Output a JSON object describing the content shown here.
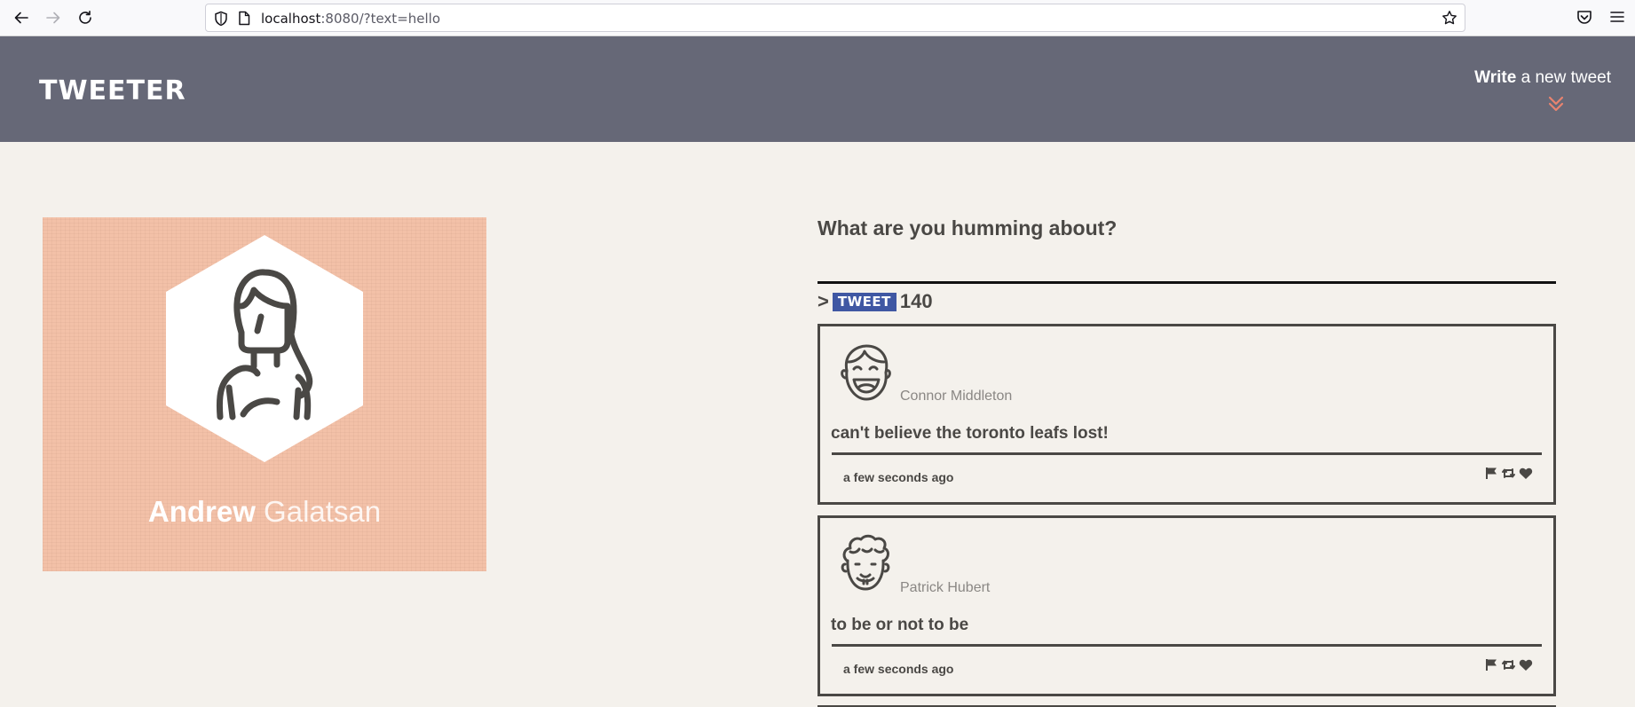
{
  "browser": {
    "url_host": "localhost",
    "url_rest": ":8080/?text=hello"
  },
  "header": {
    "logo": "TWEETER",
    "compose_bold": "Write",
    "compose_rest": " a new tweet"
  },
  "profile": {
    "first_name": "Andrew",
    "last_name": "Galatsan"
  },
  "composer": {
    "prompt": "What are you humming about?",
    "prefix": ">",
    "button_label": "TWEET",
    "counter": "140"
  },
  "tweets": [
    {
      "author": "Connor Middleton",
      "content": "can't believe the toronto leafs lost!",
      "time": "a few seconds ago"
    },
    {
      "author": "Patrick Hubert",
      "content": "to be or not to be",
      "time": "a few seconds ago"
    }
  ],
  "colors": {
    "header_bg": "#666877",
    "page_bg": "#f4f1ec",
    "accent_chevron": "#e8836f",
    "tweet_button": "#3f57a3",
    "profile_bg": "#f3c1a8"
  }
}
